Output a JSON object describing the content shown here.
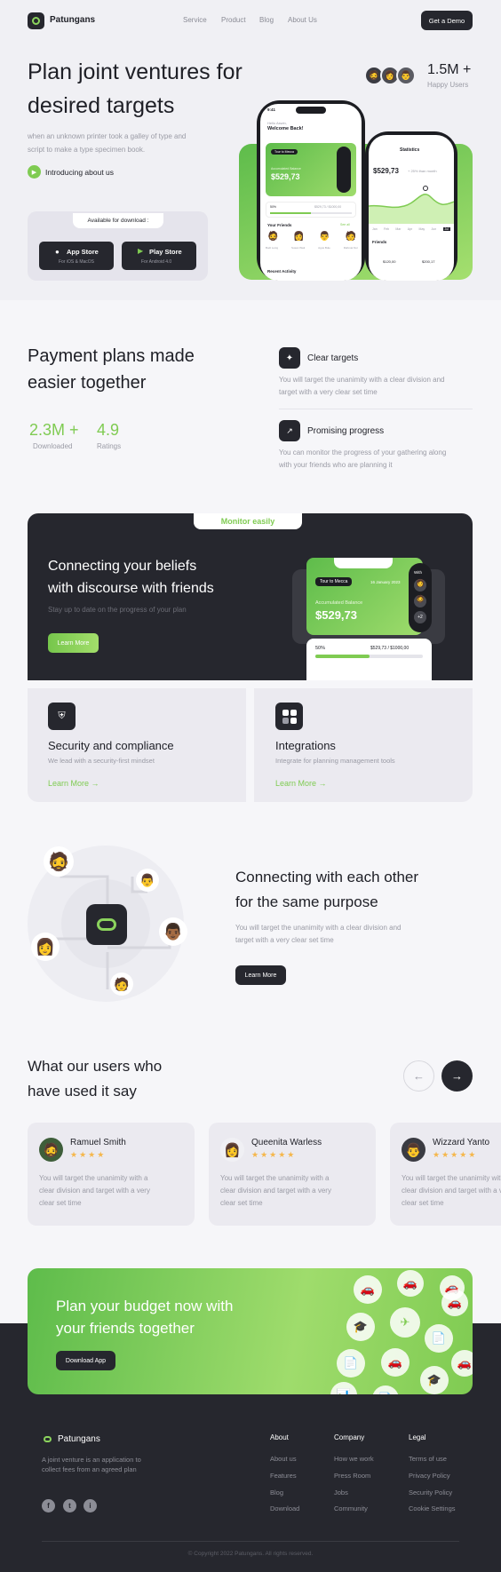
{
  "nav": {
    "brand": "Patungans",
    "links": [
      "Service",
      "Product",
      "Blog",
      "About Us"
    ],
    "cta": "Get a Demo"
  },
  "hero": {
    "title_line1": "Plan joint ventures for",
    "title_line2": "desired targets",
    "desc_line1": "when an unknown printer took a galley of type and",
    "desc_line2": "script to make a type specimen book.",
    "intro_link": "Introducing about us",
    "stat_value": "1.5M +",
    "stat_label": "Happy Users",
    "download": {
      "label": "Available for download :",
      "appstore_title": "App Store",
      "appstore_sub": "For iOS & MacOS",
      "playstore_title": "Play Store",
      "playstore_sub": "For Android 4.0"
    }
  },
  "phone_left": {
    "time": "9:41",
    "greeting": "Hello Aswin,",
    "welcome": "Welcome Back!",
    "chip": "Tour to Mecca",
    "date": "16 January 2023",
    "balance_label": "Accumulated Balance",
    "balance": "$529,73",
    "progress_pct": "50%",
    "progress_values": "$529,73 / $1000,00",
    "friends_title": "Your Friends",
    "see_all": "See all",
    "friends": [
      "Budi Lovig",
      "Susan Wati",
      "Agus Bule",
      "Rahmat Nur"
    ],
    "recent": "Recent Activity"
  },
  "phone_right": {
    "title": "Statistics",
    "amount": "$529,73",
    "amount_note": "+ 25% than month",
    "months": [
      "Jan",
      "Feb",
      "Mar",
      "Apr",
      "May",
      "Jun",
      "Jul"
    ],
    "friends_title": "Friends",
    "values": [
      "$120,00",
      "$200,17"
    ]
  },
  "payment": {
    "title_line1": "Payment plans made",
    "title_line2": "easier together",
    "stat1_value": "2.3M +",
    "stat1_label": "Downloaded",
    "stat2_value": "4.9",
    "stat2_label": "Ratings",
    "features": [
      {
        "title": "Clear targets",
        "desc_line1": "You will target the unanimity with a clear division and",
        "desc_line2": "target with a very clear set time"
      },
      {
        "title": "Promising progress",
        "desc_line1": "You can monitor the progress of your gathering along",
        "desc_line2": "with your friends who are planning it"
      }
    ]
  },
  "monitor": {
    "tab": "Monitor easily",
    "title_line1": "Connecting your beliefs",
    "title_line2": "with discourse with friends",
    "desc": "Stay up to date on the progress of your plan",
    "button": "Learn More",
    "chip": "Tour to Mecca",
    "date": "16 January 2023",
    "balance_label": "Accumulated Balance",
    "balance": "$529,73",
    "with": "With",
    "more": "+2",
    "progress_pct": "50%",
    "progress_values": "$529,73 / $1000,00"
  },
  "cards": [
    {
      "title": "Security and compliance",
      "desc": "We lead with a security-first mindset",
      "link": "Learn More"
    },
    {
      "title": "Integrations",
      "desc": "Integrate for planning management tools",
      "link": "Learn More"
    }
  ],
  "connect": {
    "title_line1": "Connecting with each other",
    "title_line2": "for the same purpose",
    "desc_line1": "You will target the unanimity with a clear division and",
    "desc_line2": "target with a very clear set time",
    "button": "Learn More"
  },
  "testimonials": {
    "title_line1": "What our users who",
    "title_line2": "have used it say",
    "items": [
      {
        "name": "Ramuel Smith",
        "stars": "★★★★",
        "text": [
          "You will target the unanimity with a",
          "clear division and target with a very",
          "clear set time"
        ]
      },
      {
        "name": "Queenita Warless",
        "stars": "★★★★★",
        "text": [
          "You will target the unanimity with a",
          "clear division and target with a very",
          "clear set time"
        ]
      },
      {
        "name": "Wizzard Yanto",
        "stars": "★★★★★",
        "text": [
          "You will target the unanimity with a",
          "clear division and target with a very",
          "clear set time"
        ]
      }
    ]
  },
  "cta": {
    "title_line1": "Plan your budget now with",
    "title_line2": "your friends together",
    "button": "Download App"
  },
  "footer": {
    "brand": "Patungans",
    "desc_line1": "A joint venture is an application to",
    "desc_line2": "collect fees from an agreed plan",
    "columns": [
      {
        "head": "About",
        "links": [
          "About us",
          "Features",
          "Blog",
          "Download"
        ]
      },
      {
        "head": "Company",
        "links": [
          "How we work",
          "Press Room",
          "Jobs",
          "Community"
        ]
      },
      {
        "head": "Legal",
        "links": [
          "Terms of use",
          "Privacy Policy",
          "Security Policy",
          "Cookie Settings"
        ]
      }
    ],
    "social": [
      "f",
      "t",
      "i"
    ],
    "copyright": "© Copyright 2022 Patungans. All rights reserved."
  },
  "colors": {
    "accent": "#7FCB52",
    "dark": "#26272E",
    "bg": "#F6F6F9"
  }
}
